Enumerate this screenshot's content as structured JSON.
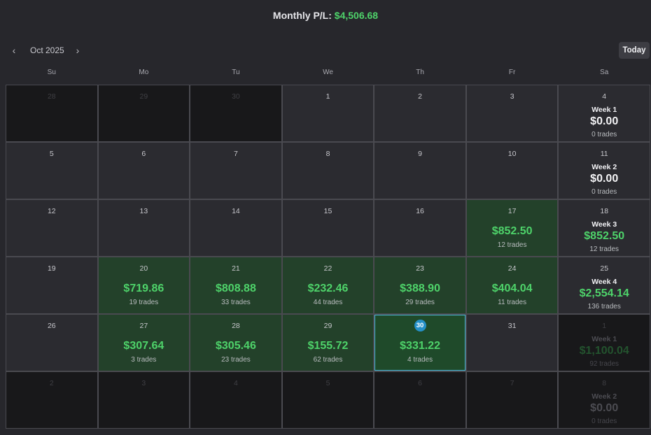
{
  "header": {
    "label": "Monthly P/L:",
    "amount": "$4,506.68"
  },
  "nav": {
    "prev_icon": "chevron-left-icon",
    "next_icon": "chevron-right-icon",
    "prev_glyph": "‹",
    "next_glyph": "›",
    "month": "Oct 2025",
    "today_label": "Today"
  },
  "weekdays": [
    "Su",
    "Mo",
    "Tu",
    "We",
    "Th",
    "Fr",
    "Sa"
  ],
  "rows": [
    {
      "days": [
        {
          "day": "28",
          "outside": true
        },
        {
          "day": "29",
          "outside": true
        },
        {
          "day": "30",
          "outside": true
        },
        {
          "day": "1"
        },
        {
          "day": "2"
        },
        {
          "day": "3"
        }
      ],
      "week": {
        "day": "4",
        "label": "Week 1",
        "pl": "$0.00",
        "trades": "0 trades",
        "positive": false,
        "dim": false
      }
    },
    {
      "days": [
        {
          "day": "5"
        },
        {
          "day": "6"
        },
        {
          "day": "7"
        },
        {
          "day": "8"
        },
        {
          "day": "9"
        },
        {
          "day": "10"
        }
      ],
      "week": {
        "day": "11",
        "label": "Week 2",
        "pl": "$0.00",
        "trades": "0 trades",
        "positive": false,
        "dim": false
      }
    },
    {
      "days": [
        {
          "day": "12"
        },
        {
          "day": "13"
        },
        {
          "day": "14"
        },
        {
          "day": "15"
        },
        {
          "day": "16"
        },
        {
          "day": "17",
          "pl": "$852.50",
          "trades": "12 trades"
        }
      ],
      "week": {
        "day": "18",
        "label": "Week 3",
        "pl": "$852.50",
        "trades": "12 trades",
        "positive": true,
        "dim": false
      }
    },
    {
      "days": [
        {
          "day": "19"
        },
        {
          "day": "20",
          "pl": "$719.86",
          "trades": "19 trades"
        },
        {
          "day": "21",
          "pl": "$808.88",
          "trades": "33 trades"
        },
        {
          "day": "22",
          "pl": "$232.46",
          "trades": "44 trades"
        },
        {
          "day": "23",
          "pl": "$388.90",
          "trades": "29 trades"
        },
        {
          "day": "24",
          "pl": "$404.04",
          "trades": "11 trades"
        }
      ],
      "week": {
        "day": "25",
        "label": "Week 4",
        "pl": "$2,554.14",
        "trades": "136 trades",
        "positive": true,
        "dim": false
      }
    },
    {
      "days": [
        {
          "day": "26"
        },
        {
          "day": "27",
          "pl": "$307.64",
          "trades": "3 trades"
        },
        {
          "day": "28",
          "pl": "$305.46",
          "trades": "23 trades"
        },
        {
          "day": "29",
          "pl": "$155.72",
          "trades": "62 trades"
        },
        {
          "day": "30",
          "pl": "$331.22",
          "trades": "4 trades",
          "today": true
        },
        {
          "day": "31"
        }
      ],
      "week": {
        "day": "1",
        "label": "Week 1",
        "pl": "$1,100.04",
        "trades": "92 trades",
        "positive": true,
        "dim": true
      }
    },
    {
      "days": [
        {
          "day": "2",
          "outside": true
        },
        {
          "day": "3",
          "outside": true
        },
        {
          "day": "4",
          "outside": true
        },
        {
          "day": "5",
          "outside": true
        },
        {
          "day": "6",
          "outside": true
        },
        {
          "day": "7",
          "outside": true
        }
      ],
      "week": {
        "day": "8",
        "label": "Week 2",
        "pl": "$0.00",
        "trades": "0 trades",
        "positive": false,
        "dim": true
      }
    }
  ]
}
